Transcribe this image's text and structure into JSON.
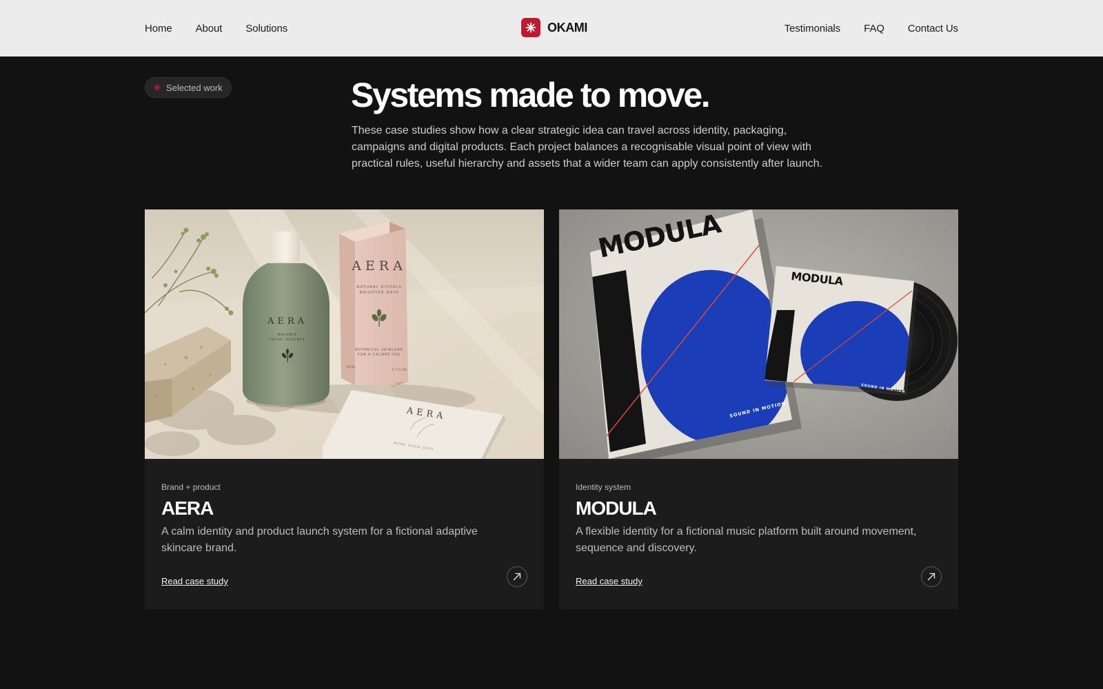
{
  "nav": {
    "left": [
      "Home",
      "About",
      "Solutions"
    ],
    "brand": "OKAMI",
    "right": [
      "Testimonials",
      "FAQ",
      "Contact Us"
    ]
  },
  "hero": {
    "badge": "Selected work",
    "title": "Systems made to move.",
    "description": "These case studies show how a clear strategic idea can travel across identity, packaging, campaigns and digital products. Each project balances a recognisable visual point of view with practical rules, useful hierarchy and assets that a wider team can apply consistently after launch."
  },
  "cards": [
    {
      "category": "Brand + product",
      "title": "AERA",
      "description": "A calm identity and product launch system for a fictional adaptive skincare brand.",
      "link": "Read case study",
      "image": {
        "box_brand": "AERA",
        "box_line1": "NATURAL RITUALS",
        "box_line2": "BRIGHTER DAYS",
        "box_foot1": "BOTANICAL SKINCARE",
        "box_foot2": "FOR A CALMER YOU",
        "box_vol": "50 ML",
        "box_oz": "1.7 FL OZ",
        "bottle_brand": "AERA",
        "bottle_line1": "BALANCE",
        "bottle_line2": "FACIAL ESSENCE",
        "card_brand": "AERA",
        "card_foot": "MORE GOOD DAYS"
      }
    },
    {
      "category": "Identity system",
      "title": "MODULA",
      "description": "A flexible identity for a fictional music platform built around movement, sequence and discovery.",
      "link": "Read case study",
      "image": {
        "poster_title": "MODULA",
        "poster_tagline": "SOUND IN MOTION",
        "sleeve_title": "MODULA",
        "sleeve_tagline": "SOUND IN MOTION"
      }
    }
  ],
  "colors": {
    "accent": "#c0182c",
    "background": "#121212",
    "card": "#1c1c1c",
    "nav": "#ececec",
    "modula_blue": "#1b3db8"
  }
}
